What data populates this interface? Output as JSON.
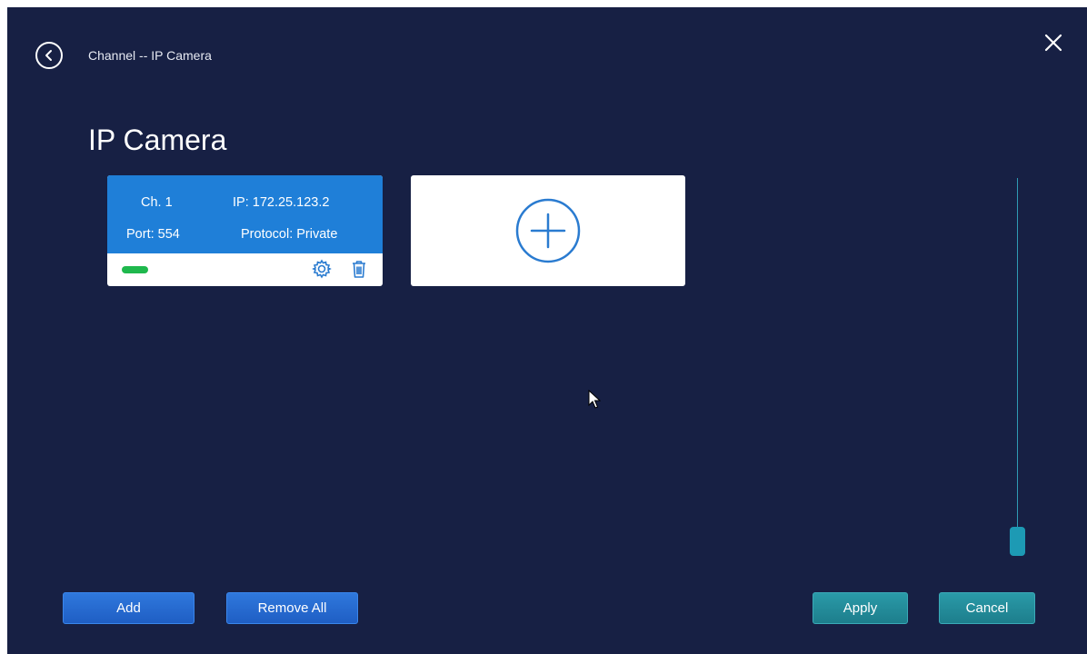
{
  "header": {
    "breadcrumb": "Channel -- IP Camera"
  },
  "page": {
    "title": "IP Camera"
  },
  "cameras": [
    {
      "channel_label": "Ch. 1",
      "ip_label": "IP: 172.25.123.2",
      "port_label": "Port: 554",
      "protocol_label": "Protocol: Private",
      "status": "online",
      "status_color": "#1fb84d"
    }
  ],
  "footer": {
    "add_label": "Add",
    "remove_all_label": "Remove All",
    "apply_label": "Apply",
    "cancel_label": "Cancel"
  },
  "colors": {
    "background": "#172044",
    "card_header": "#1f7fd8",
    "accent_teal": "#1d9ab4",
    "button_blue": "#2f78dc"
  },
  "icons": [
    "back-arrow-icon",
    "close-icon",
    "gear-icon",
    "trash-icon",
    "plus-circle-icon",
    "cursor-pointer-icon"
  ]
}
